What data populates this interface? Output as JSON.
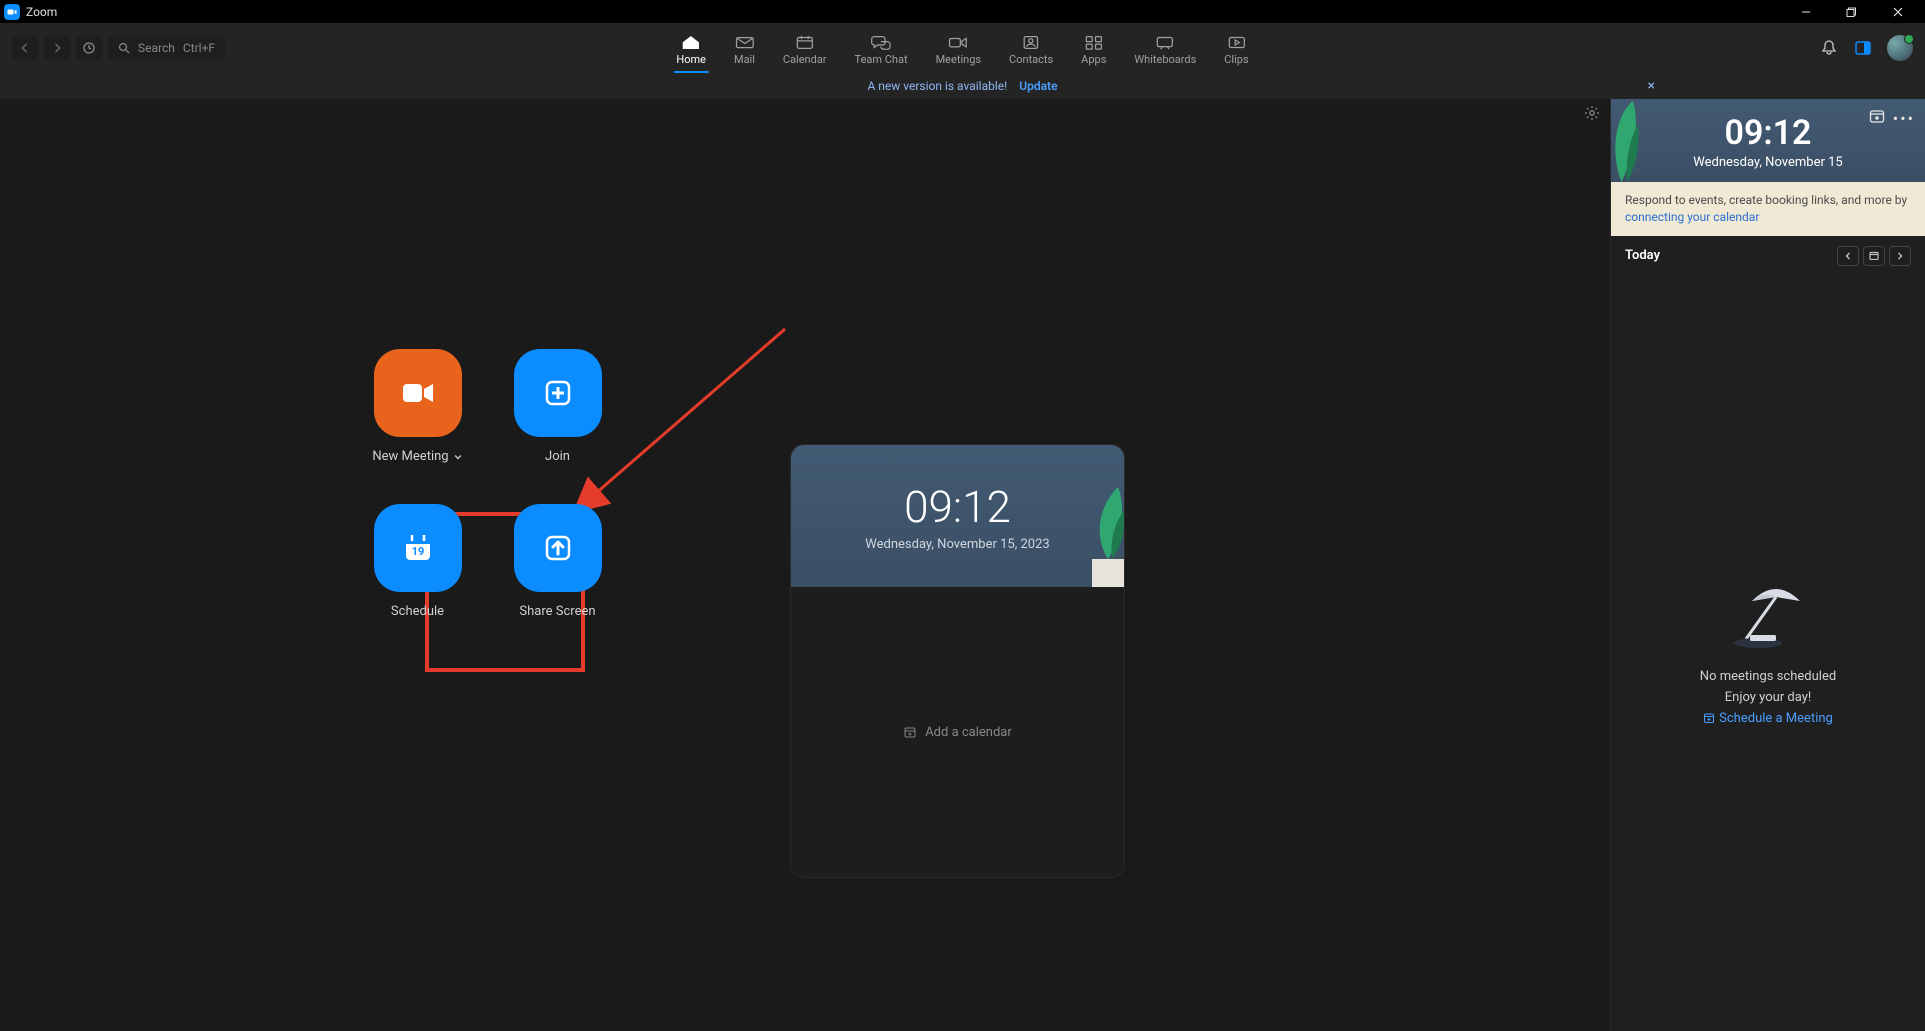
{
  "window": {
    "title": "Zoom"
  },
  "search": {
    "label": "Search",
    "shortcut": "Ctrl+F"
  },
  "tabs": [
    {
      "label": "Home"
    },
    {
      "label": "Mail"
    },
    {
      "label": "Calendar"
    },
    {
      "label": "Team Chat"
    },
    {
      "label": "Meetings"
    },
    {
      "label": "Contacts"
    },
    {
      "label": "Apps"
    },
    {
      "label": "Whiteboards"
    },
    {
      "label": "Clips"
    }
  ],
  "banner": {
    "text": "A new version is available!",
    "link": "Update"
  },
  "actions": {
    "new_meeting": "New Meeting",
    "join": "Join",
    "schedule": "Schedule",
    "share": "Share Screen",
    "schedule_date_num": "19"
  },
  "clock": {
    "time": "09:12",
    "date": "Wednesday, November 15, 2023",
    "add_calendar": "Add a calendar"
  },
  "right_panel": {
    "time": "09:12",
    "date": "Wednesday, November 15",
    "message_pre": "Respond to events, create booking links, and more by ",
    "message_link": "connecting your calendar",
    "today": "Today",
    "empty1": "No meetings scheduled",
    "empty2": "Enjoy your day!",
    "schedule_link": "Schedule a Meeting"
  }
}
